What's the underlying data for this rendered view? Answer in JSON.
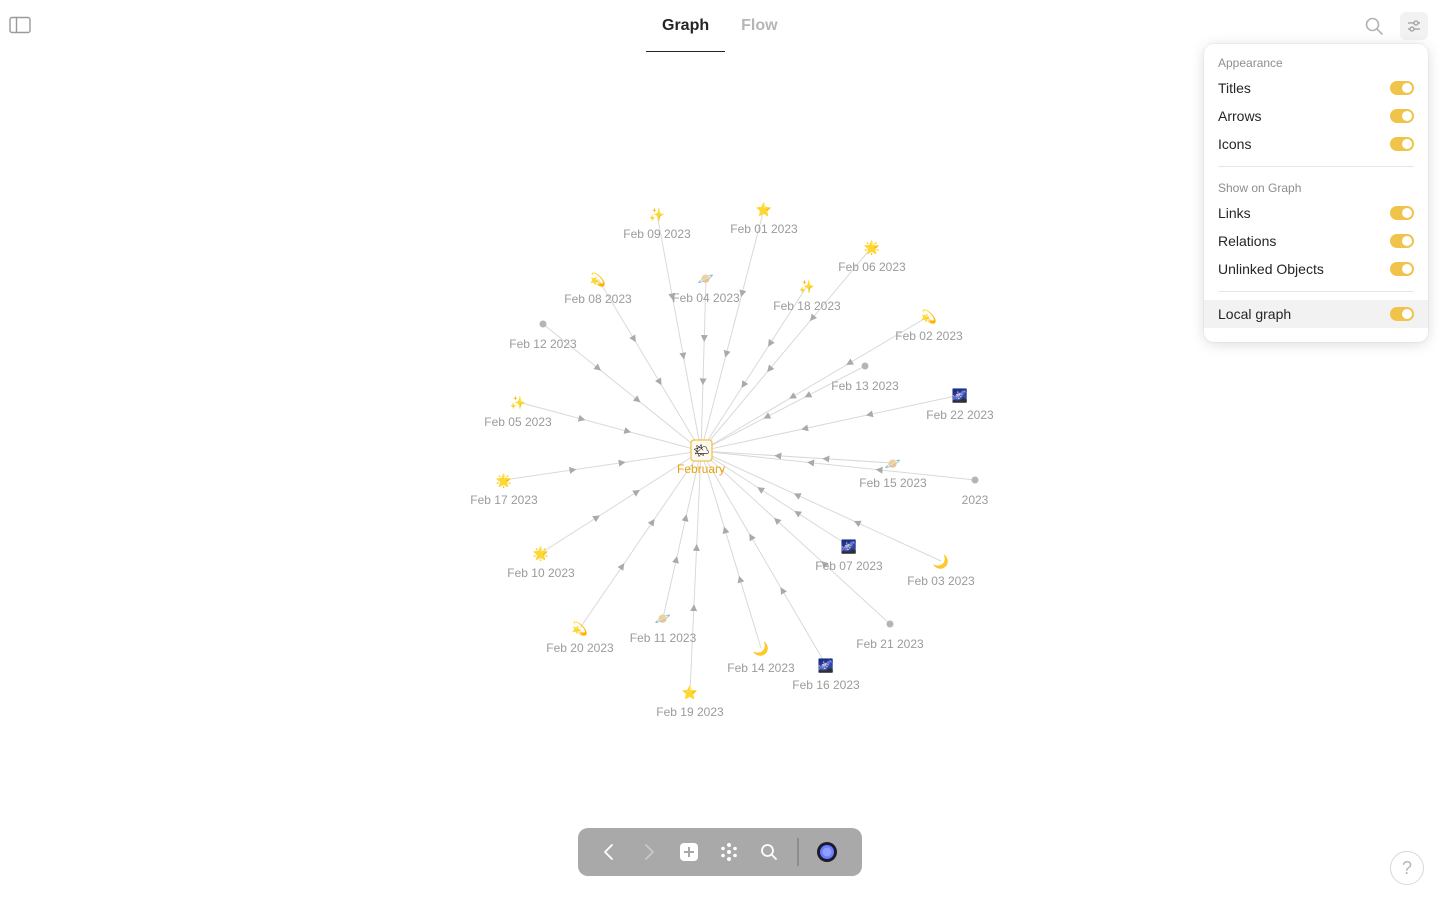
{
  "tabs": [
    {
      "label": "Graph",
      "active": true
    },
    {
      "label": "Flow",
      "active": false
    }
  ],
  "panel": {
    "appearance_title": "Appearance",
    "appearance_items": [
      {
        "label": "Titles",
        "on": true
      },
      {
        "label": "Arrows",
        "on": true
      },
      {
        "label": "Icons",
        "on": true
      }
    ],
    "show_title": "Show on Graph",
    "show_items": [
      {
        "label": "Links",
        "on": true
      },
      {
        "label": "Relations",
        "on": true
      },
      {
        "label": "Unlinked Objects",
        "on": true
      }
    ],
    "local_graph": {
      "label": "Local graph",
      "on": true
    }
  },
  "graph": {
    "center": {
      "label": "February",
      "icon": "sun-behind-cloud-icon",
      "glyph": "🌤"
    },
    "nodes": [
      {
        "label": "Feb 09 2023",
        "icon": "sparkles-icon",
        "glyph": "✨"
      },
      {
        "label": "Feb 01 2023",
        "icon": "star-icon",
        "glyph": "⭐"
      },
      {
        "label": "Feb 06 2023",
        "icon": "glowing-star-icon",
        "glyph": "🌟"
      },
      {
        "label": "Feb 08 2023",
        "icon": "dizzy-icon",
        "glyph": "💫"
      },
      {
        "label": "Feb 04 2023",
        "icon": "ringed-planet-icon",
        "glyph": "🪐"
      },
      {
        "label": "Feb 18 2023",
        "icon": "sparkles-icon",
        "glyph": "✨"
      },
      {
        "label": "Feb 12 2023",
        "icon": "dot-icon",
        "glyph": ""
      },
      {
        "label": "Feb 02 2023",
        "icon": "dizzy-icon",
        "glyph": "💫"
      },
      {
        "label": "Feb 13 2023",
        "icon": "dot-icon",
        "glyph": ""
      },
      {
        "label": "Feb 05 2023",
        "icon": "sparkles-icon",
        "glyph": "✨"
      },
      {
        "label": "Feb 22 2023",
        "icon": "night-sky-icon",
        "glyph": "🌌"
      },
      {
        "label": "Feb 15 2023",
        "icon": "ringed-planet-icon",
        "glyph": "🪐"
      },
      {
        "label": "2023",
        "icon": "dot-icon",
        "glyph": ""
      },
      {
        "label": "Feb 17 2023",
        "icon": "glowing-star-icon",
        "glyph": "🌟"
      },
      {
        "label": "Feb 10 2023",
        "icon": "glowing-star-icon",
        "glyph": "🌟"
      },
      {
        "label": "Feb 07 2023",
        "icon": "night-sky-icon",
        "glyph": "🌌"
      },
      {
        "label": "Feb 03 2023",
        "icon": "crescent-moon-icon",
        "glyph": "🌙"
      },
      {
        "label": "Feb 21 2023",
        "icon": "dot-icon",
        "glyph": ""
      },
      {
        "label": "Feb 20 2023",
        "icon": "dizzy-icon",
        "glyph": "💫"
      },
      {
        "label": "Feb 11 2023",
        "icon": "ringed-planet-icon",
        "glyph": "🪐"
      },
      {
        "label": "Feb 14 2023",
        "icon": "crescent-moon-icon",
        "glyph": "🌙"
      },
      {
        "label": "Feb 16 2023",
        "icon": "night-sky-icon",
        "glyph": "🌌"
      },
      {
        "label": "Feb 19 2023",
        "icon": "star-icon",
        "glyph": "⭐"
      }
    ]
  },
  "help": {
    "label": "?"
  },
  "colors": {
    "accent": "#f0c34b",
    "center_label": "#e8a20c",
    "node_label": "#9b9b9b",
    "edge": "#d9d9d9",
    "toolbar_bg": "#a9a9a9"
  }
}
